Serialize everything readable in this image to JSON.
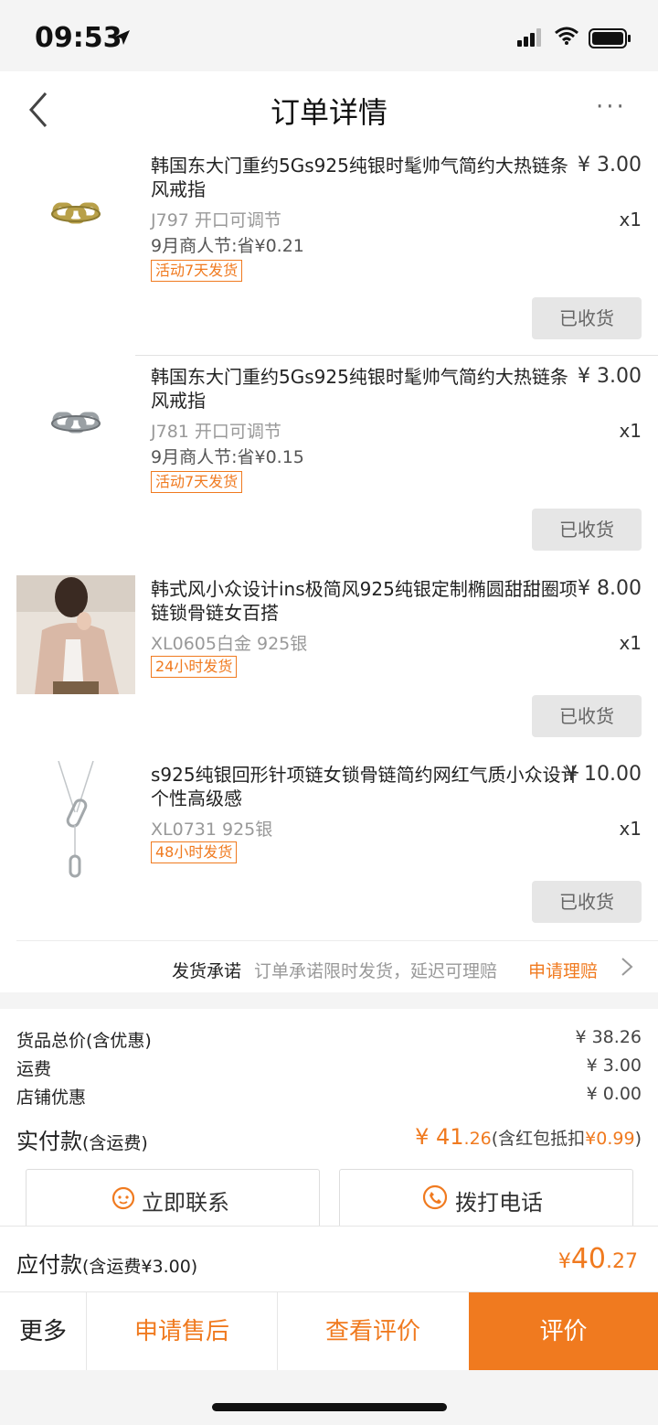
{
  "status_bar": {
    "time": "09:53"
  },
  "header": {
    "title": "订单详情",
    "more": "···"
  },
  "items": [
    {
      "name": "韩国东大门重约5Gs925纯银时髦帅气简约大热链条风戒指",
      "price": "¥ 3.00",
      "spec": "J797 开口可调节",
      "qty": "x1",
      "promo": "9月商人节:省¥0.21",
      "tag": "活动7天发货",
      "button": "已收货",
      "image": "gold-chain-ring"
    },
    {
      "name": "韩国东大门重约5Gs925纯银时髦帅气简约大热链条风戒指",
      "price": "¥ 3.00",
      "spec": "J781 开口可调节",
      "qty": "x1",
      "promo": "9月商人节:省¥0.15",
      "tag": "活动7天发货",
      "button": "已收货",
      "image": "silver-chain-ring"
    },
    {
      "name": "韩式风小众设计ins极简风925纯银定制椭圆甜甜圈项链锁骨链女百搭",
      "price": "¥ 8.00",
      "spec": "XL0605白金 925银",
      "qty": "x1",
      "tag": "24小时发货",
      "button": "已收货",
      "image": "model-photo"
    },
    {
      "name": "s925纯银回形针项链女锁骨链简约网红气质小众设计个性高级感",
      "price": "¥ 10.00",
      "spec": "XL0731 925银",
      "qty": "x1",
      "tag": "48小时发货",
      "button": "已收货",
      "image": "paperclip-necklace"
    }
  ],
  "promise": {
    "label": "发货承诺",
    "text": "订单承诺限时发货，延迟可理赔",
    "link": "申请理赔"
  },
  "summary": {
    "rows": [
      {
        "label": "货品总价(含优惠)",
        "value": "¥ 38.26"
      },
      {
        "label": "运费",
        "value": "¥ 3.00"
      },
      {
        "label": "店铺优惠",
        "value": "¥ 0.00"
      }
    ],
    "paid_label": "实付款",
    "paid_note": "(含运费)",
    "paid_symbol": "¥ ",
    "paid_int": "41",
    "paid_dec": ".26",
    "paid_extra": "(含红包抵扣",
    "paid_extra_amount": "¥0.99",
    "paid_extra_close": ")",
    "contact_button": "立即联系",
    "call_button": "拨打电话"
  },
  "due": {
    "label": "应付款",
    "note": "(含运费¥3.00)",
    "symbol": "¥",
    "int": "40",
    "dec": ".27"
  },
  "bottom_bar": {
    "more": "更多",
    "after_sale": "申请售后",
    "view_review": "查看评价",
    "review": "评价"
  },
  "colors": {
    "accent": "#f07a1f",
    "background": "#f4f4f4"
  }
}
